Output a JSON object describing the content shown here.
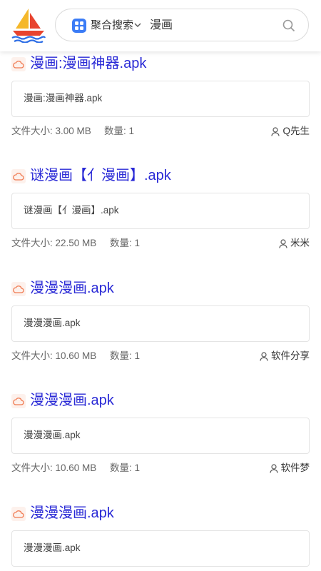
{
  "header": {
    "scope_label": "聚合搜索",
    "query": "漫画"
  },
  "colors": {
    "link": "#2a2ad6",
    "accent_blue": "#3b7cf6",
    "cloud_orange": "#f07b52"
  },
  "icons": {
    "logo": "sailboat-logo",
    "scope": "grid-icon",
    "dropdown": "chevron-down-icon",
    "search": "search-icon",
    "cloud": "cloud-icon",
    "user": "user-icon"
  },
  "results": [
    {
      "title": "漫画:漫画神器.apk",
      "snippet": "漫画:漫画神器.apk",
      "size": "文件大小: 3.00 MB",
      "count": "数量: 1",
      "uploader": "Q先生"
    },
    {
      "title": "谜漫画【亻漫画】.apk",
      "snippet": "谜漫画【亻漫画】.apk",
      "size": "文件大小: 22.50 MB",
      "count": "数量: 1",
      "uploader": "米米"
    },
    {
      "title": "漫漫漫画.apk",
      "snippet": "漫漫漫画.apk",
      "size": "文件大小: 10.60 MB",
      "count": "数量: 1",
      "uploader": "软件分享"
    },
    {
      "title": "漫漫漫画.apk",
      "snippet": "漫漫漫画.apk",
      "size": "文件大小: 10.60 MB",
      "count": "数量: 1",
      "uploader": "软件梦"
    },
    {
      "title": "漫漫漫画.apk",
      "snippet": "漫漫漫画.apk",
      "size": "",
      "count": "",
      "uploader": ""
    }
  ]
}
